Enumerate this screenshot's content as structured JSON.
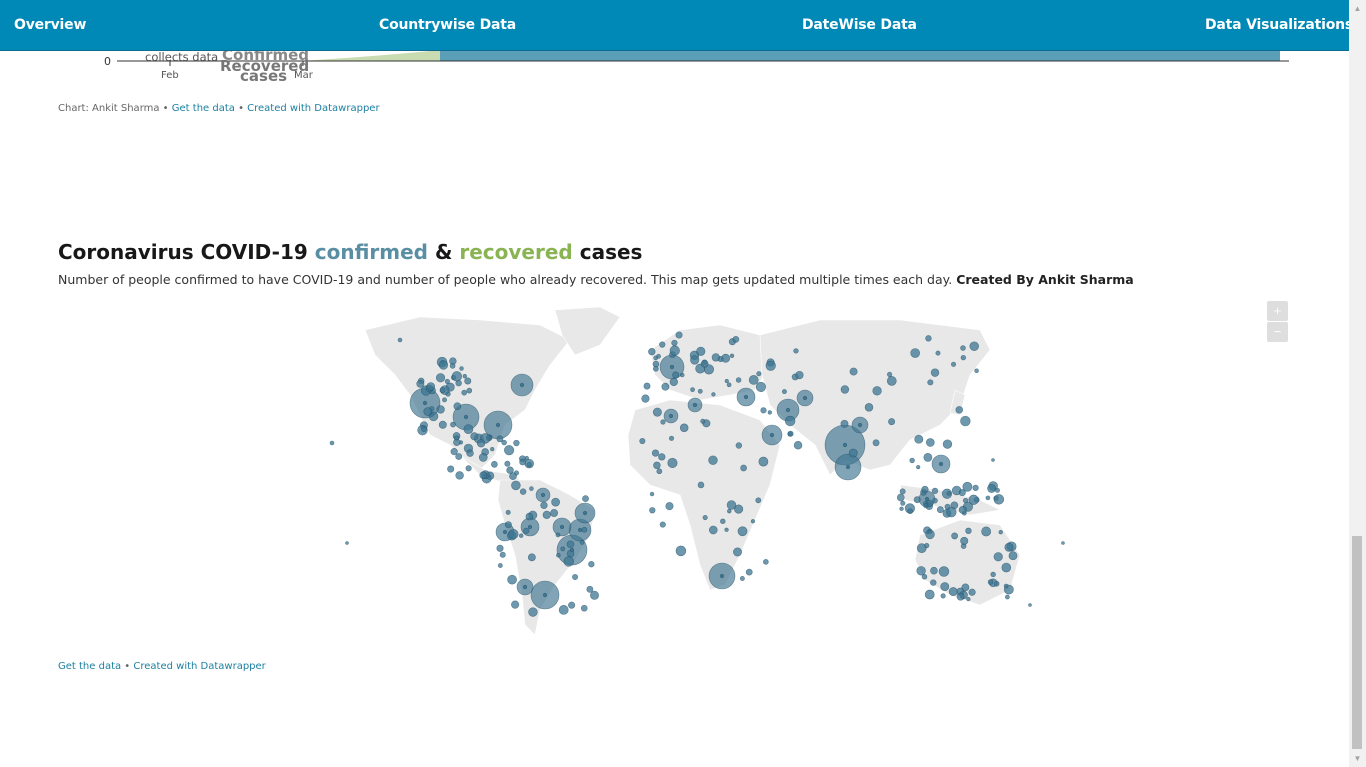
{
  "nav": {
    "items": [
      "Overview",
      "Countrywise Data",
      "DateWise Data",
      "Data Visualizations"
    ]
  },
  "top_chart": {
    "zero_tick": "0",
    "annotation": "collects data",
    "label_confirmed": "Confirmed",
    "label_recovered": "Recovered",
    "label_cases": "cases",
    "x_ticks": [
      "Feb",
      "Mar"
    ],
    "credit_author": "Chart: Ankit Sharma",
    "credit_get_data": "Get the data",
    "credit_created": "Created with Datawrapper"
  },
  "map_section": {
    "title_prefix": "Coronavirus COVID-19 ",
    "title_confirmed": "confirmed",
    "title_amp": " & ",
    "title_recovered": "recovered",
    "title_suffix": " cases",
    "subtitle": "Number of people confirmed to have COVID-19 and number of people who already recovered. This map gets updated multiple times each day. ",
    "subtitle_bold": "Created By Ankit Sharma",
    "zoom_in": "+",
    "zoom_out": "−",
    "credit_get_data": "Get the data",
    "credit_created": "Created with Datawrapper"
  },
  "colors": {
    "navbar": "#0089b7",
    "confirmed": "#5a8fa3",
    "recovered": "#8ab453",
    "bubble": "#3e7591",
    "land": "#e8e8e8"
  },
  "scrollbar": {
    "up": "▲",
    "down": "▼"
  }
}
